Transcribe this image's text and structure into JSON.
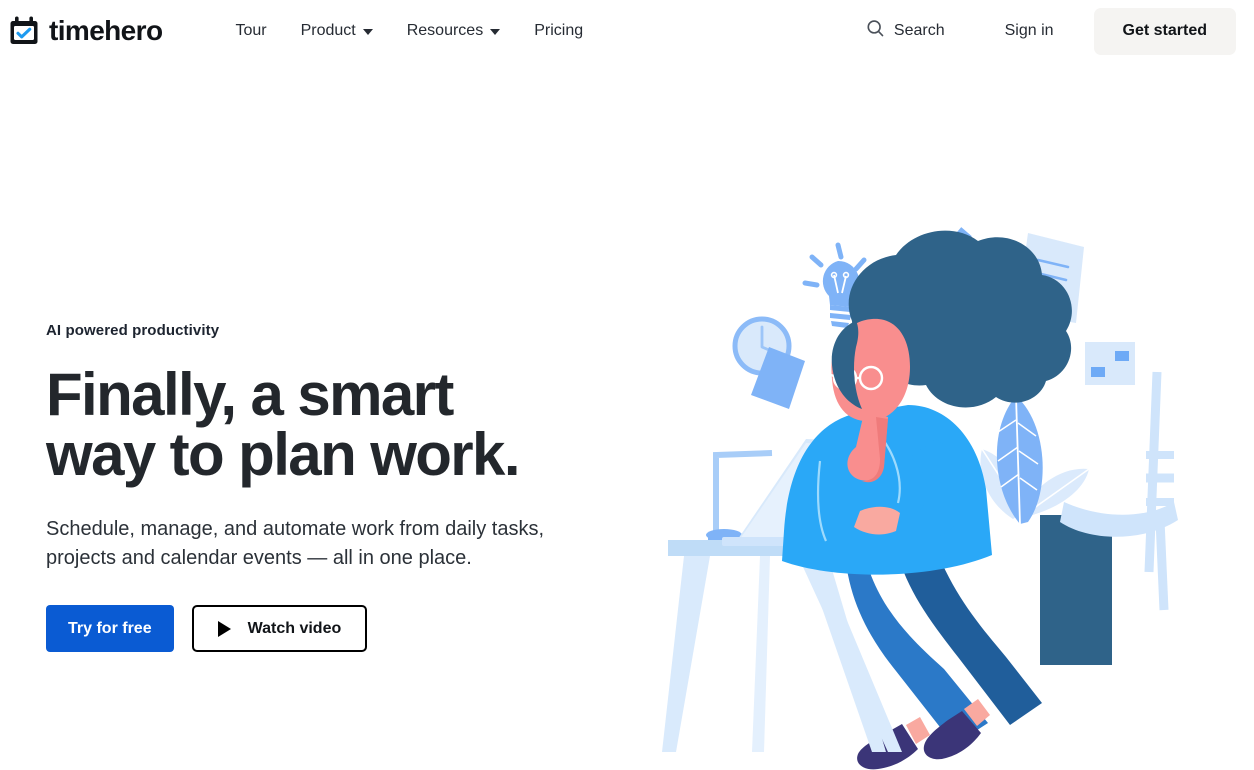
{
  "header": {
    "brand": {
      "name": "timehero",
      "icon": "calendar-check-icon"
    },
    "nav": [
      {
        "label": "Tour",
        "has_dropdown": false
      },
      {
        "label": "Product",
        "has_dropdown": true
      },
      {
        "label": "Resources",
        "has_dropdown": true
      },
      {
        "label": "Pricing",
        "has_dropdown": false
      }
    ],
    "search_label": "Search",
    "search_icon": "search-icon",
    "signin_label": "Sign in",
    "get_started_label": "Get started"
  },
  "hero": {
    "eyebrow": "AI powered productivity",
    "title_line1": "Finally, a smart",
    "title_line2": "way to plan work.",
    "subtitle": "Schedule, manage, and automate work from daily tasks, projects and calendar events — all in one place.",
    "primary_cta": "Try for free",
    "secondary_cta": "Watch video",
    "secondary_cta_icon": "play-icon"
  },
  "illustration": {
    "name": "woman-working-at-desk-illustration",
    "elements": [
      "lightbulb-icon",
      "checkmark-icon",
      "clock-icon",
      "document-icon",
      "note-card-icon",
      "desk-lamp",
      "laptop",
      "desk",
      "chair",
      "woman-character",
      "potted-plant"
    ]
  },
  "colors": {
    "accent_blue": "#0a5bd3",
    "button_gray": "#f5f4f2",
    "text_dark": "#23272c",
    "illustration_light_blue": "#7fb3f7",
    "illustration_pale_blue": "#d6e7fb",
    "illustration_navy": "#2f6389",
    "illustration_bright_blue": "#2aa8f7",
    "illustration_skin": "#f98e8e"
  }
}
